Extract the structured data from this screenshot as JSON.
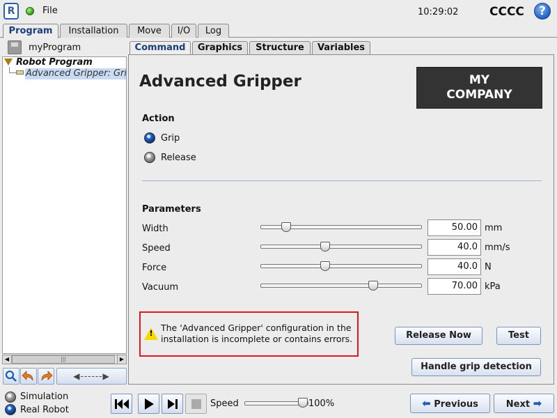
{
  "topbar": {
    "logo_text": "R",
    "file_label": "File",
    "clock": "10:29:02",
    "robot_name": "CCCC",
    "help_label": "?"
  },
  "main_tabs": [
    "Program",
    "Installation",
    "Move",
    "I/O",
    "Log"
  ],
  "program": {
    "name": "myProgram",
    "tree_root": "Robot Program",
    "tree_child": "Advanced Gripper: Grip"
  },
  "content_tabs": [
    "Command",
    "Graphics",
    "Structure",
    "Variables"
  ],
  "node": {
    "title": "Advanced Gripper",
    "company_logo_line1": "MY",
    "company_logo_line2": "COMPANY"
  },
  "action": {
    "title": "Action",
    "options": [
      {
        "label": "Grip",
        "selected": true
      },
      {
        "label": "Release",
        "selected": false
      }
    ]
  },
  "parameters": {
    "title": "Parameters",
    "items": [
      {
        "label": "Width",
        "value": "50.00",
        "unit": "mm",
        "level": 0.16
      },
      {
        "label": "Speed",
        "value": "40.0",
        "unit": "mm/s",
        "level": 0.4
      },
      {
        "label": "Force",
        "value": "40.0",
        "unit": "N",
        "level": 0.4
      },
      {
        "label": "Vacuum",
        "value": "70.00",
        "unit": "kPa",
        "level": 0.7
      }
    ]
  },
  "error": {
    "message": "The 'Advanced Gripper' configuration in the installation is incomplete or contains errors."
  },
  "buttons": {
    "release_now": "Release Now",
    "test": "Test",
    "grip_detection": "Handle grip detection"
  },
  "bottom": {
    "simulation_label": "Simulation",
    "real_robot_label": "Real Robot",
    "speed_label": "Speed",
    "speed_value": "100%",
    "previous_label": "Previous",
    "next_label": "Next"
  },
  "colors": {
    "accent": "#1d3d7a",
    "error_border": "#e0161c",
    "warning": "#f5d900"
  }
}
